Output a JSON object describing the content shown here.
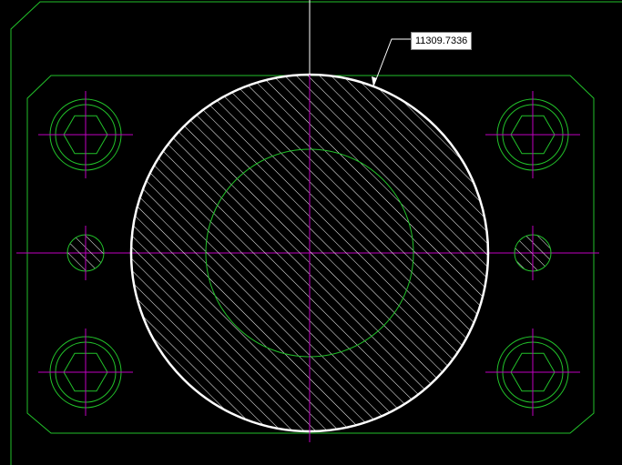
{
  "viewport": {
    "background": "#000000",
    "geometry_color": "#22c12a",
    "centerline_color": "#c000c0",
    "highlight_color": "#ffffff",
    "cursor_color": "#ffffff"
  },
  "tooltip": {
    "area_value": "11309.7336"
  },
  "icons": {
    "crosshair": "crosshair-cursor-icon",
    "hatch": "hatch-pattern-icon"
  }
}
